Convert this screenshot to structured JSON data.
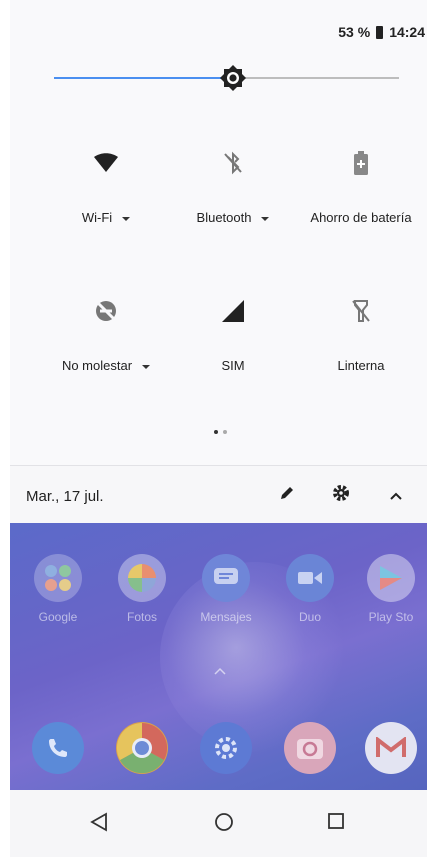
{
  "status_bar": {
    "battery": "53 %",
    "time": "14:24"
  },
  "brightness": {
    "level": 0.52
  },
  "tiles": [
    {
      "label": "Wi-Fi",
      "icon": "wifi-icon",
      "has_menu": true
    },
    {
      "label": "Bluetooth",
      "icon": "bluetooth-off-icon",
      "has_menu": true
    },
    {
      "label": "Ahorro de batería",
      "icon": "battery-saver-icon",
      "has_menu": false
    },
    {
      "label": "No molestar",
      "icon": "do-not-disturb-icon",
      "has_menu": true
    },
    {
      "label": "SIM",
      "icon": "signal-icon",
      "has_menu": false
    },
    {
      "label": "Linterna",
      "icon": "flashlight-off-icon",
      "has_menu": false
    }
  ],
  "footer": {
    "date": "Mar., 17 jul."
  },
  "background": {
    "search_label": "Google",
    "app_row": [
      "Google",
      "Fotos",
      "Mensajes",
      "Duo",
      "Play Sto"
    ]
  },
  "colors": {
    "accent": "#4a8ff0",
    "home_bg": "#6c64c8"
  }
}
